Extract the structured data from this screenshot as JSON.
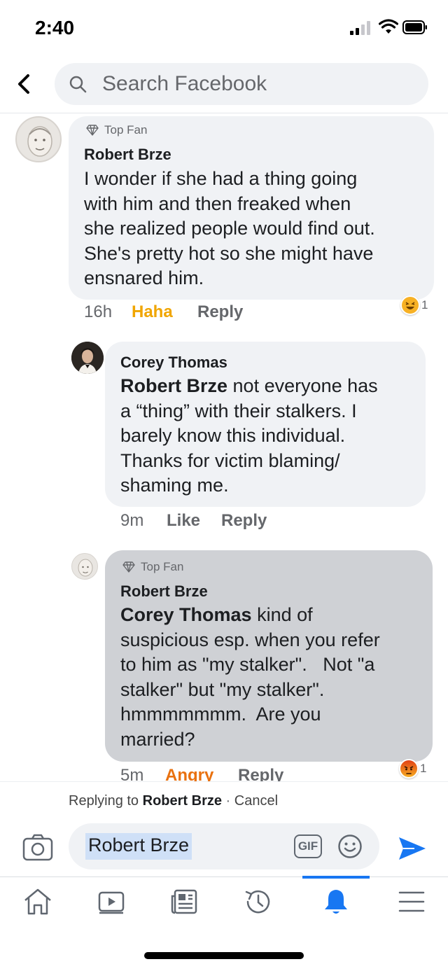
{
  "status_bar": {
    "time": "2:40"
  },
  "header": {
    "search_placeholder": "Search Facebook"
  },
  "comments": [
    {
      "badge": "Top Fan",
      "author": "Robert Brze",
      "lines": [
        "I wonder if she had a thing going",
        "with him and then freaked when",
        "she realized people would find out.",
        "She's pretty hot so she might have",
        "ensnared him."
      ],
      "time": "16h",
      "reaction_label": "Haha",
      "reply_label": "Reply",
      "reaction_count": "1",
      "reaction_color": "#f7b125"
    },
    {
      "author": "Corey Thomas",
      "mention": "Robert Brze",
      "first_line_rest": " not everyone has",
      "lines": [
        "a “thing” with their stalkers. I",
        "barely know this individual.",
        "Thanks for victim blaming/",
        "shaming me."
      ],
      "time": "9m",
      "like_label": "Like",
      "reply_label": "Reply"
    },
    {
      "badge": "Top Fan",
      "author": "Robert Brze",
      "mention": "Corey Thomas",
      "first_line_rest": " kind of",
      "lines": [
        "suspicious esp. when you refer",
        "to him as \"my stalker\".   Not \"a",
        "stalker\" but \"my stalker\".",
        "hmmmmmmm.  Are you",
        "married?"
      ],
      "time": "5m",
      "reaction_label": "Angry",
      "reply_label": "Reply",
      "reaction_count": "1",
      "reaction_color": "#e9710f"
    }
  ],
  "reply_bar": {
    "prefix": "Replying to ",
    "name": "Robert Brze",
    "separator": " · ",
    "cancel": "Cancel"
  },
  "composer": {
    "text": "Robert Brze",
    "gif_label": "GIF"
  },
  "colors": {
    "accent": "#1877f2",
    "bubble": "#f0f2f5",
    "bubble_active": "#cfd1d5",
    "meta_text": "#65676b"
  },
  "icons": [
    "back-arrow-icon",
    "search-icon",
    "diamond-icon",
    "camera-icon",
    "emoji-icon",
    "send-icon",
    "home-icon",
    "watch-icon",
    "news-icon",
    "memories-icon",
    "bell-icon",
    "menu-icon"
  ]
}
